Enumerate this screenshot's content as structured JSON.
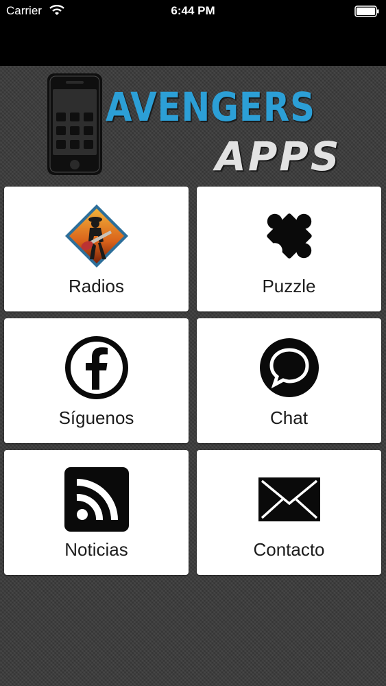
{
  "status_bar": {
    "carrier": "Carrier",
    "time": "6:44 PM"
  },
  "logo": {
    "word1": "AVENGERS",
    "word2": "APPS",
    "accent_color": "#2c9fd6"
  },
  "menu": [
    {
      "label": "Radios",
      "icon": "guitarist-icon"
    },
    {
      "label": "Puzzle",
      "icon": "puzzle-piece-icon"
    },
    {
      "label": "Síguenos",
      "icon": "facebook-icon"
    },
    {
      "label": "Chat",
      "icon": "chat-bubble-icon"
    },
    {
      "label": "Noticias",
      "icon": "rss-icon"
    },
    {
      "label": "Contacto",
      "icon": "envelope-icon"
    }
  ]
}
